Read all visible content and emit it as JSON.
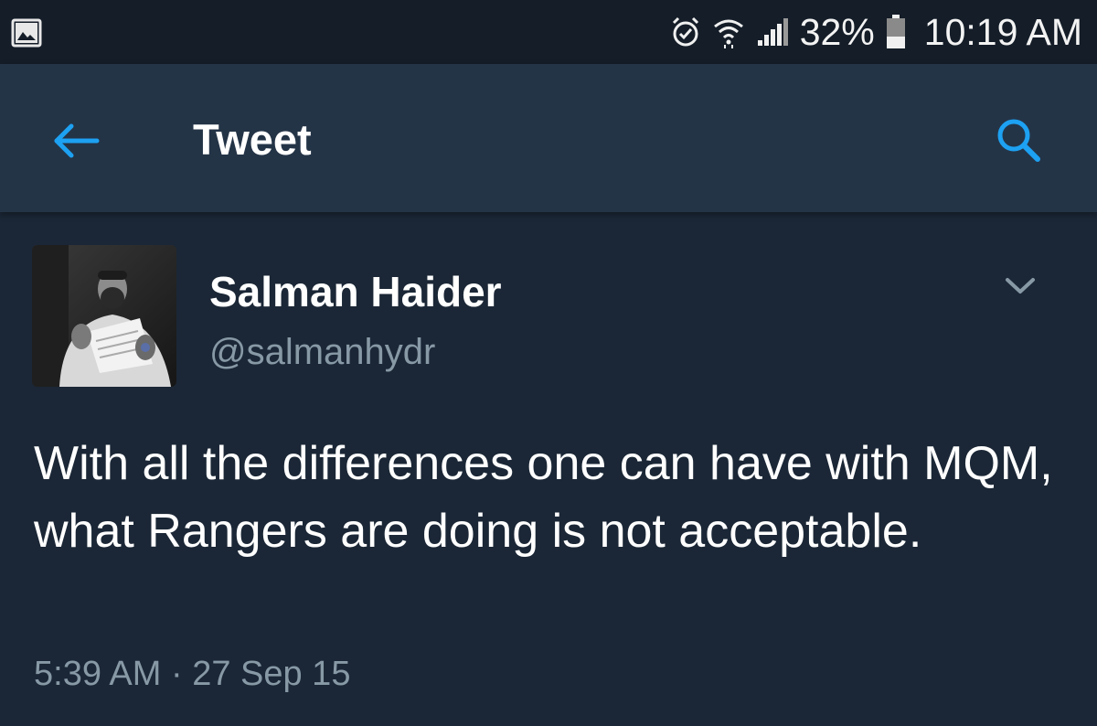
{
  "status_bar": {
    "battery_percent": "32%",
    "time": "10:19 AM",
    "icons": [
      "gallery-icon",
      "alarm-icon",
      "wifi-icon",
      "signal-icon",
      "battery-icon"
    ]
  },
  "header": {
    "title": "Tweet",
    "icons": [
      "back-arrow-icon",
      "search-icon"
    ],
    "accent_color": "#1da1f2",
    "background_color": "#243447"
  },
  "tweet": {
    "author_name": "Salman Haider",
    "author_handle": "@salmanhydr",
    "text": "With all the differences one can have with MQM, what Rangers are doing is not acceptable.",
    "timestamp": "5:39 AM · 27 Sep 15",
    "background_color": "#1b2736",
    "secondary_text_color": "#8899a6"
  }
}
